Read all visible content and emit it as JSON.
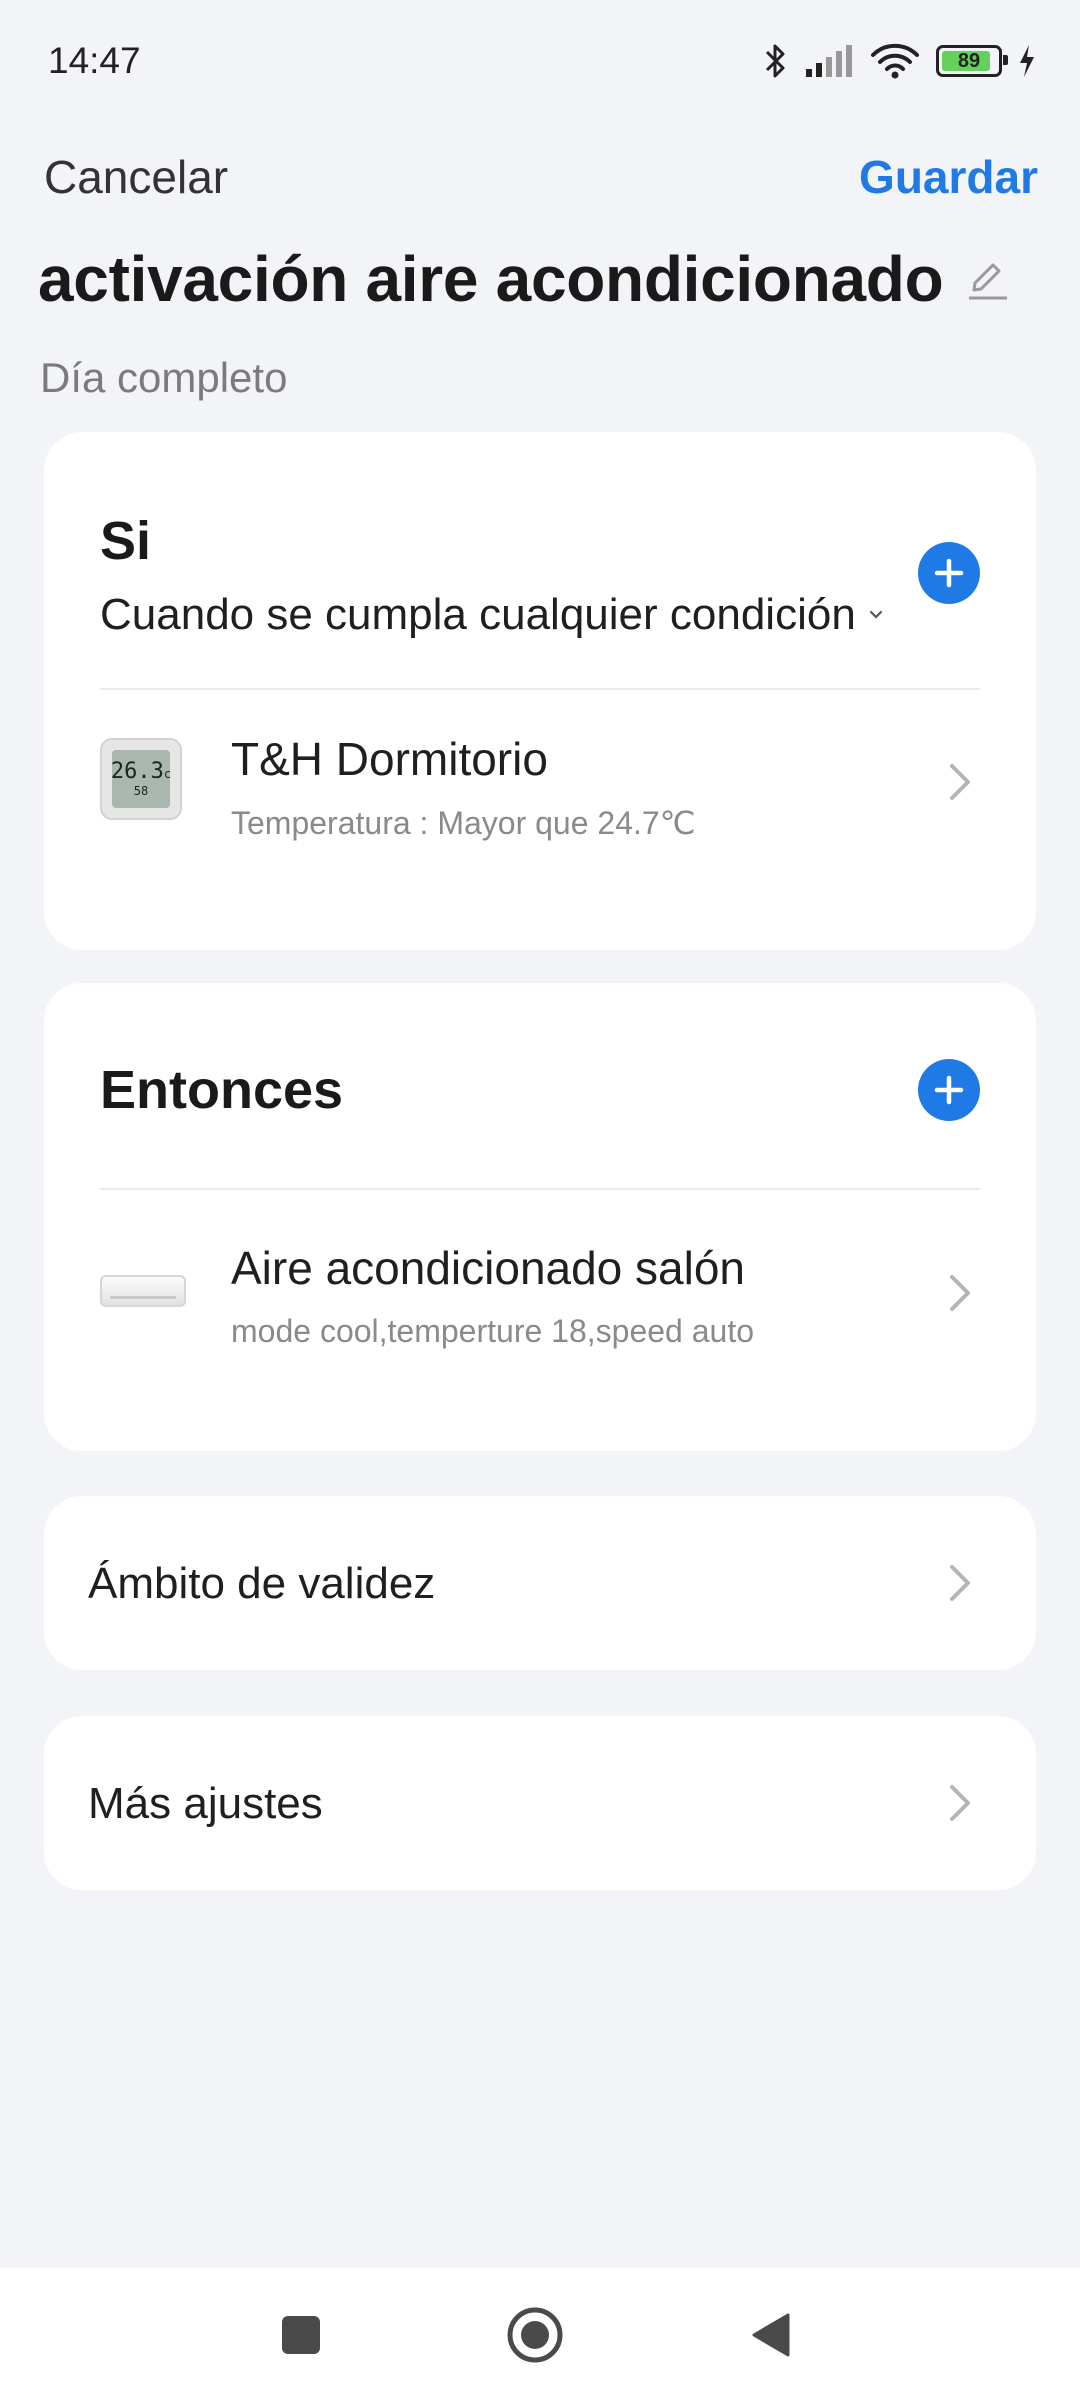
{
  "status_bar": {
    "time": "14:47",
    "battery_level": "89",
    "battery_fraction": 0.89,
    "icons": [
      "bluetooth-icon",
      "signal-icon",
      "wifi-icon",
      "battery-icon",
      "charging-icon"
    ]
  },
  "header": {
    "cancel_label": "Cancelar",
    "save_label": "Guardar",
    "title": "activación aire acondicionado",
    "subtitle": "Día completo"
  },
  "if_section": {
    "title": "Si",
    "condition_mode": "Cuando se cumpla cualquier condición",
    "items": [
      {
        "device": "T&H Dormitorio",
        "detail": "Temperatura : Mayor que 24.7℃",
        "icon": "thermometer-device-icon",
        "screen_main": "26.3",
        "screen_unit": "c",
        "screen_sub": "58"
      }
    ]
  },
  "then_section": {
    "title": "Entonces",
    "items": [
      {
        "device": "Aire acondicionado salón",
        "detail": "mode cool,temperture 18,speed auto",
        "icon": "air-conditioner-icon"
      }
    ]
  },
  "settings": {
    "scope_label": "Ámbito de validez",
    "more_label": "Más ajustes"
  },
  "colors": {
    "accent": "#1f7ae6",
    "background": "#f3f4f8",
    "card": "#ffffff",
    "battery_fill": "#62d25b"
  }
}
